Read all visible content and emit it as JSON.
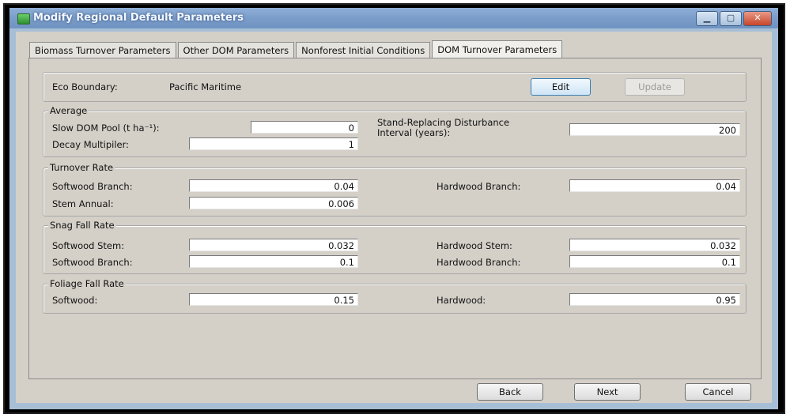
{
  "window": {
    "title": "Modify Regional Default Parameters"
  },
  "tabs": [
    {
      "label": "Biomass Turnover Parameters"
    },
    {
      "label": "Other DOM Parameters"
    },
    {
      "label": "Nonforest Initial Conditions"
    },
    {
      "label": "DOM Turnover Parameters"
    }
  ],
  "eco": {
    "label": "Eco Boundary:",
    "value": "Pacific Maritime",
    "edit": "Edit",
    "update": "Update"
  },
  "average": {
    "title": "Average",
    "slow_dom_label": "Slow DOM Pool  (t ha⁻¹):",
    "slow_dom_value": "0",
    "decay_label": "Decay Multipiler:",
    "decay_value": "1",
    "srd_label_1": "Stand-Replacing Disturbance",
    "srd_label_2": "Interval (years):",
    "srd_value": "200"
  },
  "turnover": {
    "title": "Turnover Rate",
    "softwood_branch_label": "Softwood Branch:",
    "softwood_branch_value": "0.04",
    "hardwood_branch_label": "Hardwood Branch:",
    "hardwood_branch_value": "0.04",
    "stem_annual_label": "Stem Annual:",
    "stem_annual_value": "0.006"
  },
  "snag": {
    "title": "Snag Fall Rate",
    "softwood_stem_label": "Softwood Stem:",
    "softwood_stem_value": "0.032",
    "hardwood_stem_label": "Hardwood Stem:",
    "hardwood_stem_value": "0.032",
    "softwood_branch_label": "Softwood Branch:",
    "softwood_branch_value": "0.1",
    "hardwood_branch_label": "Hardwood Branch:",
    "hardwood_branch_value": "0.1"
  },
  "foliage": {
    "title": "Foliage Fall Rate",
    "softwood_label": "Softwood:",
    "softwood_value": "0.15",
    "hardwood_label": "Hardwood:",
    "hardwood_value": "0.95"
  },
  "footer": {
    "back": "Back",
    "next": "Next",
    "cancel": "Cancel"
  }
}
